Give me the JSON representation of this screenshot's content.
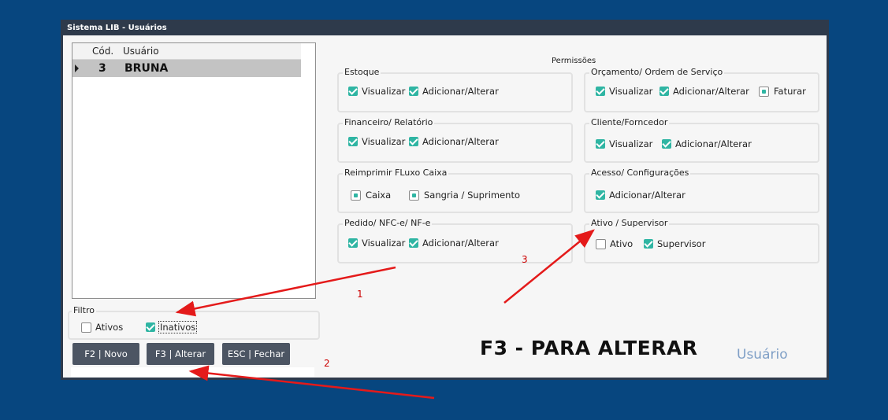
{
  "window": {
    "title": "Sistema LIB - Usuários"
  },
  "grid": {
    "columns": [
      "Cód.",
      "Usuário"
    ],
    "rows": [
      {
        "cod": "3",
        "usuario": "BRUNA"
      }
    ]
  },
  "filtro": {
    "legend": "Filtro",
    "ativos": {
      "label": "Ativos",
      "checked": false
    },
    "inativos": {
      "label": "Inativos",
      "checked": true
    }
  },
  "buttons": {
    "novo": "F2 | Novo",
    "alterar": "F3 | Alterar",
    "fechar": "ESC | Fechar"
  },
  "permissoes": {
    "title": "Permissões",
    "estoque": {
      "legend": "Estoque",
      "visualizar": "Visualizar",
      "adicionar": "Adicionar/Alterar"
    },
    "orcamento": {
      "legend": "Orçamento/ Ordem de Serviço",
      "visualizar": "Visualizar",
      "adicionar": "Adicionar/Alterar",
      "faturar": "Faturar"
    },
    "financeiro": {
      "legend": "Financeiro/ Relatório",
      "visualizar": "Visualizar",
      "adicionar": "Adicionar/Alterar"
    },
    "cliente": {
      "legend": "Cliente/Forncedor",
      "visualizar": "Visualizar",
      "adicionar": "Adicionar/Alterar"
    },
    "reimprimir": {
      "legend": "Reimprimir FLuxo Caixa",
      "caixa": "Caixa",
      "sangria": "Sangria / Suprimento"
    },
    "acesso": {
      "legend": "Acesso/ Configurações",
      "adicionar": "Adicionar/Alterar"
    },
    "pedido": {
      "legend": "Pedido/ NFC-e/ NF-e",
      "visualizar": "Visualizar",
      "adicionar": "Adicionar/Alterar"
    },
    "ativo": {
      "legend": "Ativo / Supervisor",
      "ativo": "Ativo",
      "supervisor": "Supervisor",
      "ativo_checked": false,
      "supervisor_checked": true
    }
  },
  "footer": {
    "instruction": "F3 - PARA ALTERAR",
    "label": "Usuário"
  },
  "annotations": {
    "n1": "1",
    "n2": "2",
    "n3": "3"
  },
  "colors": {
    "background": "#07467f",
    "accent": "#2fb5a3",
    "arrow": "#e41a1a",
    "button": "#4c5563"
  }
}
